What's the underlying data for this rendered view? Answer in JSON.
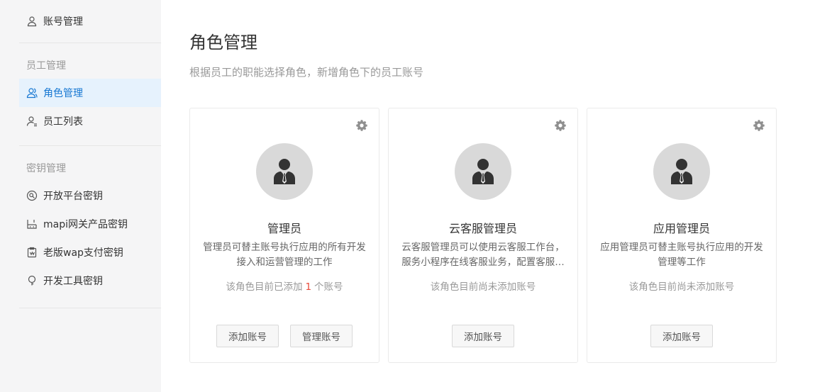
{
  "sidebar": {
    "account": {
      "label": "账号管理",
      "icon": "user-icon"
    },
    "staff_group": {
      "title": "员工管理",
      "items": [
        {
          "label": "角色管理",
          "icon": "users-icon",
          "active": true
        },
        {
          "label": "员工列表",
          "icon": "user-list-icon",
          "active": false
        }
      ]
    },
    "key_group": {
      "title": "密钥管理",
      "items": [
        {
          "label": "开放平台密钥",
          "icon": "key-search-icon"
        },
        {
          "label": "mapi网关产品密钥",
          "icon": "gateway-icon"
        },
        {
          "label": "老版wap支付密钥",
          "icon": "clipboard-icon"
        },
        {
          "label": "开发工具密钥",
          "icon": "bulb-icon"
        }
      ]
    }
  },
  "main": {
    "title": "角色管理",
    "description": "根据员工的职能选择角色，新增角色下的员工账号",
    "cards": [
      {
        "name": "管理员",
        "desc": "管理员可替主账号执行应用的所有开发接入和运营管理的工作",
        "count_prefix": "该角色目前已添加",
        "count_num": "1",
        "count_suffix": "个账号",
        "buttons": [
          "添加账号",
          "管理账号"
        ]
      },
      {
        "name": "云客服管理员",
        "desc": "云客服管理员可以使用云客服工作台，服务小程序在线客服业务，配置客服相关设置",
        "count_text": "该角色目前尚未添加账号",
        "buttons": [
          "添加账号"
        ]
      },
      {
        "name": "应用管理员",
        "desc": "应用管理员可替主账号执行应用的开发管理等工作",
        "count_text": "该角色目前尚未添加账号",
        "buttons": [
          "添加账号"
        ]
      }
    ]
  },
  "colors": {
    "accent": "#1677d2",
    "active_bg": "#e6f2fd",
    "sidebar_bg": "#f5f5f6",
    "count_highlight": "#e84a3a",
    "avatar_bg": "#d9d9d9"
  }
}
